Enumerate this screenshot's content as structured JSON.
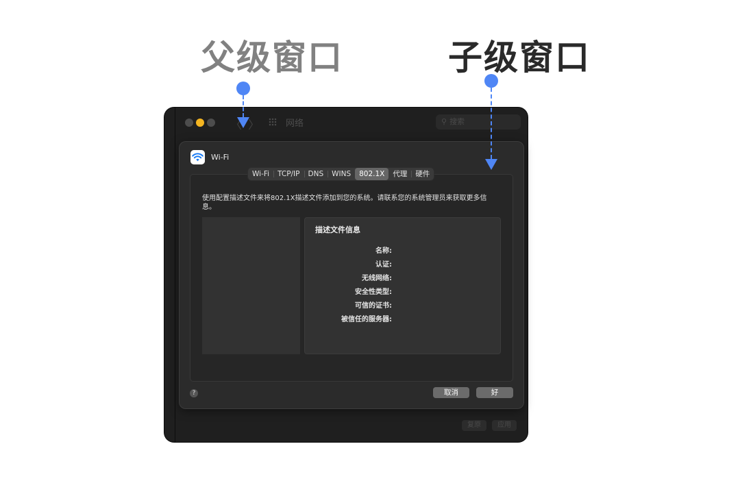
{
  "annotations": {
    "parent_window_label": "父级窗口",
    "child_window_label": "子级窗口"
  },
  "main_window": {
    "title": "网络",
    "search_placeholder": "搜索",
    "back_glyph": "〈",
    "forward_glyph": "〉",
    "revert_button": "复原",
    "apply_button": "应用"
  },
  "sheet": {
    "interface_name": "Wi-Fi",
    "tabs": [
      {
        "label": "Wi-Fi",
        "selected": false
      },
      {
        "label": "TCP/IP",
        "selected": false
      },
      {
        "label": "DNS",
        "selected": false
      },
      {
        "label": "WINS",
        "selected": false
      },
      {
        "label": "802.1X",
        "selected": true
      },
      {
        "label": "代理",
        "selected": false
      },
      {
        "label": "硬件",
        "selected": false
      }
    ],
    "description": "使用配置描述文件来将802.1X描述文件添加到您的系统。请联系您的系统管理员来获取更多信息。",
    "profile_info": {
      "title": "描述文件信息",
      "fields": [
        "名称:",
        "认证:",
        "无线网络:",
        "安全性类型:",
        "可信的证书:",
        "被信任的服务器:"
      ]
    },
    "help_glyph": "?",
    "cancel_button": "取消",
    "ok_button": "好"
  },
  "colors": {
    "accent_blue": "#4f86f5",
    "parent_label": "#818181",
    "child_label": "#2a2a2a",
    "minimize_yellow": "#f4b521",
    "window_bg": "#1f1f1f",
    "sheet_bg": "#2b2b2b"
  },
  "icons": {
    "wifi": "wifi-icon",
    "search": "magnifying-glass-icon",
    "grid": "app-grid-icon",
    "help": "question-mark-icon"
  }
}
